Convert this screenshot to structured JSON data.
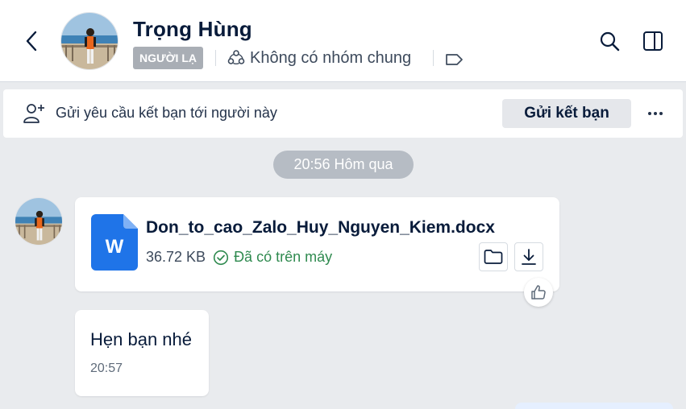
{
  "header": {
    "name": "Trọng Hùng",
    "stranger_badge": "NGƯỜI LẠ",
    "common_group": "Không có nhóm chung",
    "icons": {
      "back": "chevron-left-icon",
      "group": "group-icon",
      "tag": "tag-icon",
      "search": "search-icon",
      "panel": "sidebar-panel-icon"
    }
  },
  "friend_request": {
    "text": "Gửi yêu cầu kết bạn tới người này",
    "button": "Gửi kết bạn",
    "icons": {
      "add_user": "add-user-icon",
      "more": "more-icon"
    }
  },
  "timeline": {
    "divider": "20:56 Hôm qua"
  },
  "messages": [
    {
      "type": "file",
      "file_name": "Don_to_cao_Zalo_Huy_Nguyen_Kiem.docx",
      "file_size": "36.72 KB",
      "status": "Đã có trên máy",
      "file_icon_letter": "W",
      "icons": {
        "folder": "folder-icon",
        "download": "download-icon",
        "react": "thumbs-up-icon"
      }
    },
    {
      "type": "text",
      "text": "Hẹn bạn nhé",
      "time": "20:57"
    }
  ],
  "colors": {
    "background": "#e9ebee",
    "bubble": "#ffffff",
    "stranger_badge": "#a9aeb5",
    "time_pill": "#b6bcc4",
    "success": "#2f8a4f",
    "word_blue": "#1f74e8",
    "text_primary": "#081b3a"
  }
}
